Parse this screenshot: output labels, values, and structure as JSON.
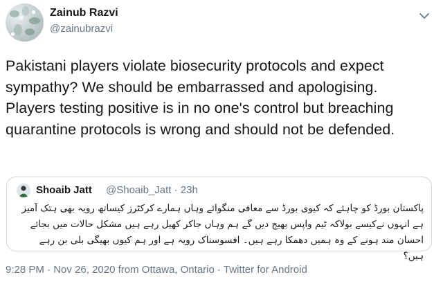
{
  "author": {
    "display_name": "Zainub Razvi",
    "handle": "@zainubrazvi"
  },
  "tweet": {
    "text": "Pakistani players violate biosecurity protocols and expect sympathy? We should be embarrassed and apologising. Players testing positive is in no one's control but breaching quarantine protocols is wrong and should not be defended."
  },
  "quoted_tweet": {
    "display_name": "Shoaib Jatt",
    "handle_time": "@Shoaib_Jatt · 23h",
    "text": "پاکستان بورڈ کو چاہئے کہ کیوی بورڈ سے معافی منگوائے وہاں ہمارے کرکٹرز کیساتھ رویہ بھی ہتک آمیز ہے انہوں نےکیسے بولاکہ ٹیم واپس بھیج دیں گے ہم وہاں جاکر کھیل رہے ہیں مشکل حالات میں بجائے احسان مند ہونے کے وہ ہمیں دھمکا رہے ہیں۔ افسوسناک رویہ ہے اور ہم کیوں بھیگی بلی بن رہے ہیں؟"
  },
  "meta": {
    "time": "9:28 PM",
    "separator": " · ",
    "date": "Nov 26, 2020",
    "location": " from Ottawa, Ontario",
    "client": "Twitter for Android"
  },
  "icons": {
    "menu": "chevron-down-icon",
    "avatar": "flower-avatar",
    "quoted_avatar": "person-avatar"
  },
  "colors": {
    "text_primary": "#14171a",
    "text_secondary": "#657786",
    "border": "#ccd6dd"
  }
}
